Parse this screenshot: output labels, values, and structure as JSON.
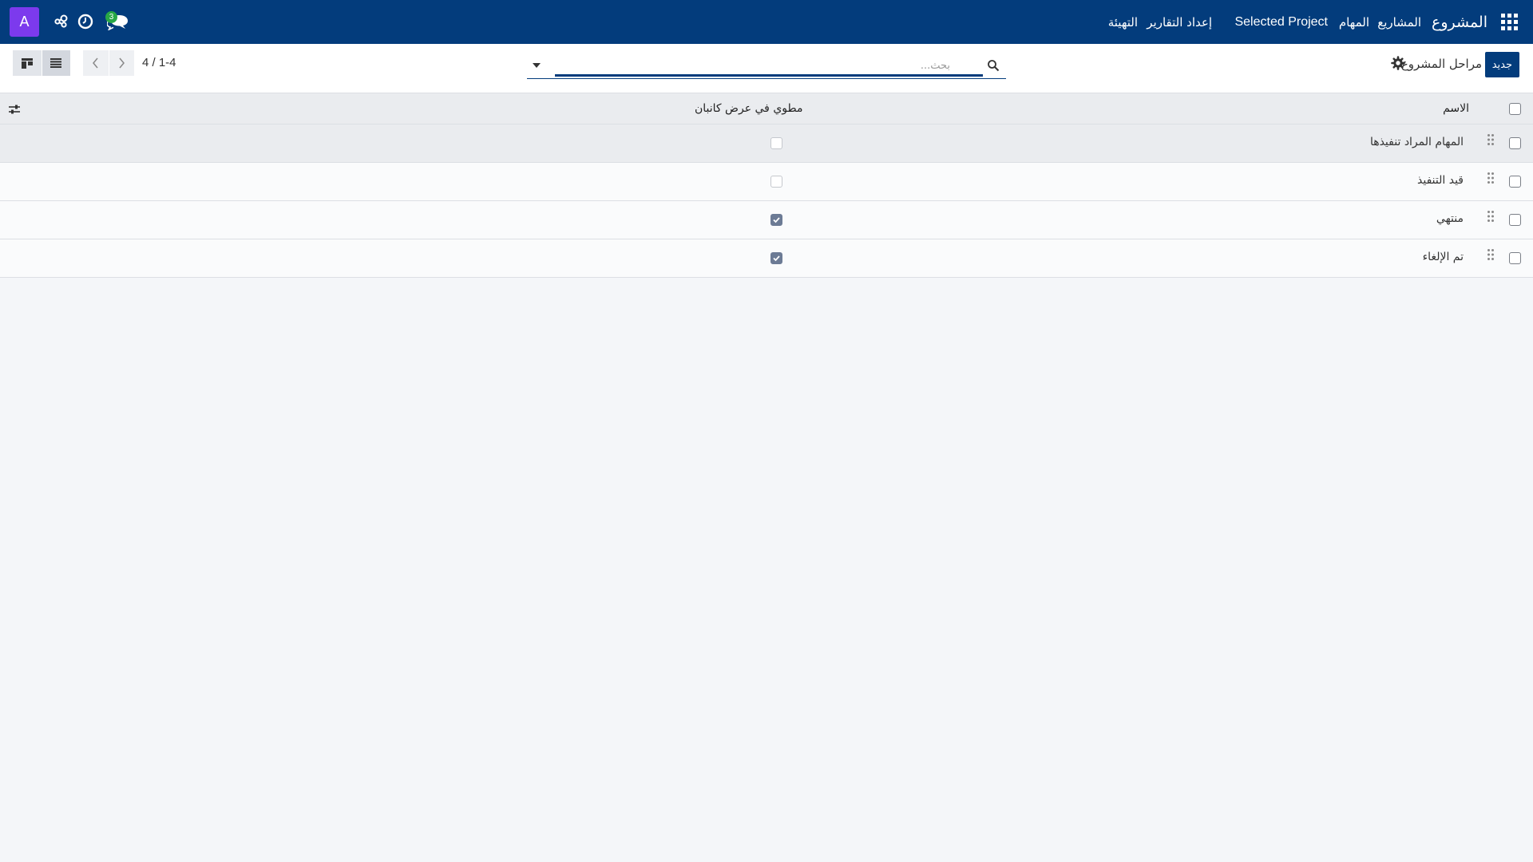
{
  "navbar": {
    "brand": "المشروع",
    "menu": [
      "المشاريع",
      "المهام",
      "Selected Project",
      "إعداد التقارير",
      "التهيئة"
    ],
    "user_initial": "A",
    "messages_count": "3",
    "color": "#033c7c"
  },
  "control_panel": {
    "new_button": "جديد",
    "title": "مراحل المشروع",
    "search_placeholder": "بحث...",
    "pager_value": "4 / 1-4"
  },
  "table": {
    "headers": {
      "name": "الاسم",
      "fold": "مطوي في عرض كانبان"
    },
    "rows": [
      {
        "name": "المهام المراد تنفيذها",
        "folded": false
      },
      {
        "name": "قيد التنفيذ",
        "folded": false
      },
      {
        "name": "منتهي",
        "folded": true
      },
      {
        "name": "تم الإلغاء",
        "folded": true
      }
    ]
  }
}
